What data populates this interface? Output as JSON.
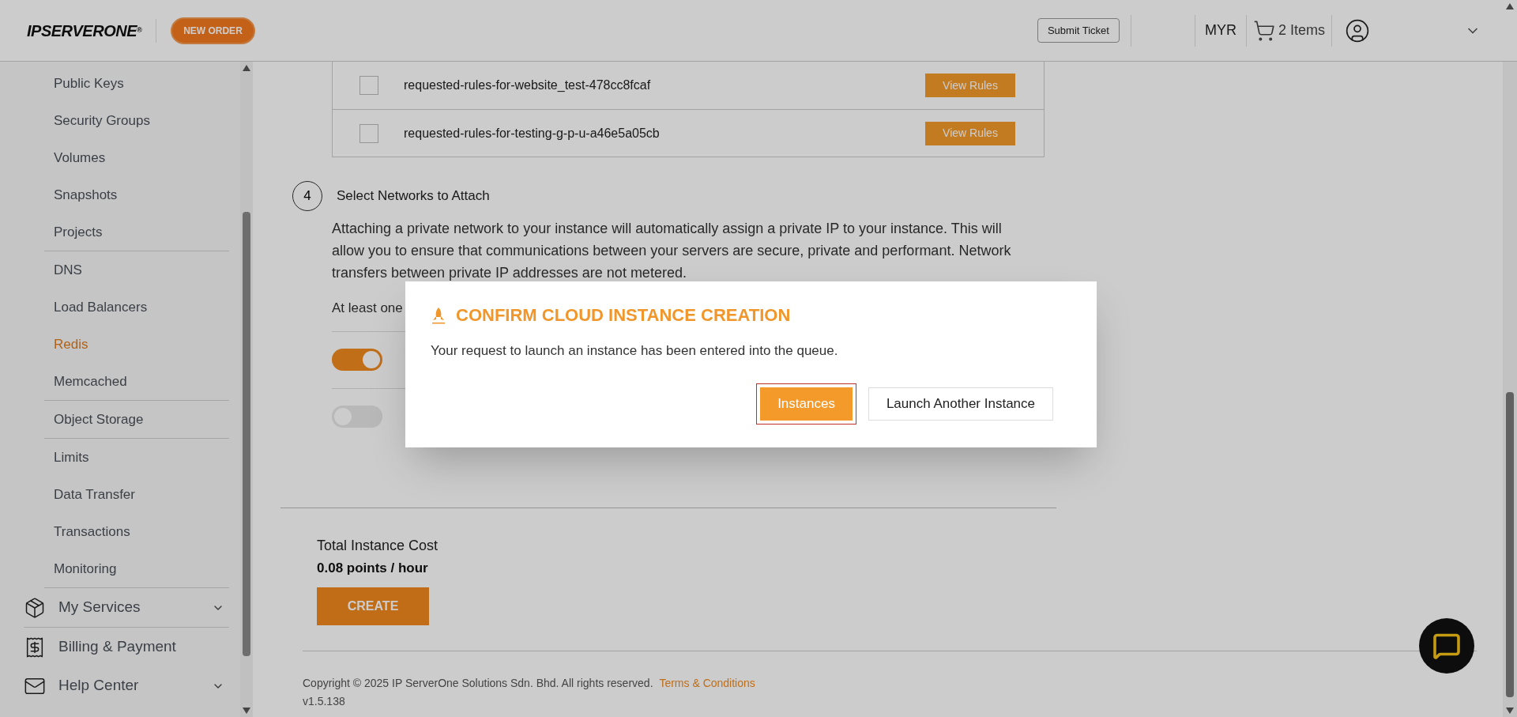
{
  "header": {
    "logo": "IPSERVERONE",
    "logo_mark": "®",
    "new_order": "NEW ORDER",
    "submit_ticket": "Submit Ticket",
    "currency": "MYR",
    "cart": "2 Items"
  },
  "sidebar": {
    "groups": [
      [
        {
          "label": "Public Keys",
          "kind": "sub",
          "selected": false
        },
        {
          "label": "Security Groups",
          "kind": "sub",
          "selected": false
        },
        {
          "label": "Volumes",
          "kind": "sub",
          "selected": false
        },
        {
          "label": "Snapshots",
          "kind": "sub",
          "selected": false
        },
        {
          "label": "Projects",
          "kind": "sub",
          "selected": false
        }
      ],
      [
        {
          "label": "DNS",
          "kind": "sub",
          "selected": false
        },
        {
          "label": "Load Balancers",
          "kind": "sub",
          "selected": false
        },
        {
          "label": "Redis",
          "kind": "sub",
          "selected": true
        },
        {
          "label": "Memcached",
          "kind": "sub",
          "selected": false
        }
      ],
      [
        {
          "label": "Object Storage",
          "kind": "sub",
          "selected": false
        }
      ],
      [
        {
          "label": "Limits",
          "kind": "sub",
          "selected": false
        },
        {
          "label": "Data Transfer",
          "kind": "sub",
          "selected": false
        },
        {
          "label": "Transactions",
          "kind": "sub",
          "selected": false
        },
        {
          "label": "Monitoring",
          "kind": "sub",
          "selected": false
        }
      ],
      [
        {
          "label": "My Services",
          "kind": "services",
          "expandable": true
        }
      ],
      [
        {
          "label": "Billing & Payment",
          "kind": "billing",
          "expandable": false
        },
        {
          "label": "Help Center",
          "kind": "help",
          "expandable": true
        }
      ]
    ]
  },
  "security_groups": [
    {
      "name": "requested-rules-for-website_test-478cc8fcaf",
      "checked": false,
      "action": "View Rules"
    },
    {
      "name": "requested-rules-for-testing-g-p-u-a46e5a05cb",
      "checked": false,
      "action": "View Rules"
    }
  ],
  "networks_step": {
    "number": "4",
    "title": "Select Networks to Attach",
    "description": "Attaching a private network to your instance will automatically assign a private IP to your instance. This will allow you to ensure that communications between your servers are secure, private and performant. Network transfers between private IP addresses are not metered.",
    "note": "At least one",
    "networks": [
      {
        "on": true
      },
      {
        "on": false
      }
    ]
  },
  "cost": {
    "label": "Total Instance Cost",
    "value": "0.08 points / hour",
    "create": "CREATE"
  },
  "footer": {
    "copyright": "Copyright © 2025 IP ServerOne Solutions Sdn. Bhd. All rights reserved.",
    "terms": "Terms & Conditions",
    "version": "v1.5.138"
  },
  "dialog": {
    "title": "CONFIRM CLOUD INSTANCE CREATION",
    "message": "Your request to launch an instance has been entered into the queue.",
    "buttons": [
      {
        "label": "Instances",
        "kind": "primary",
        "focused": true
      },
      {
        "label": "Launch Another Instance",
        "kind": "secondary",
        "focused": false
      }
    ]
  }
}
